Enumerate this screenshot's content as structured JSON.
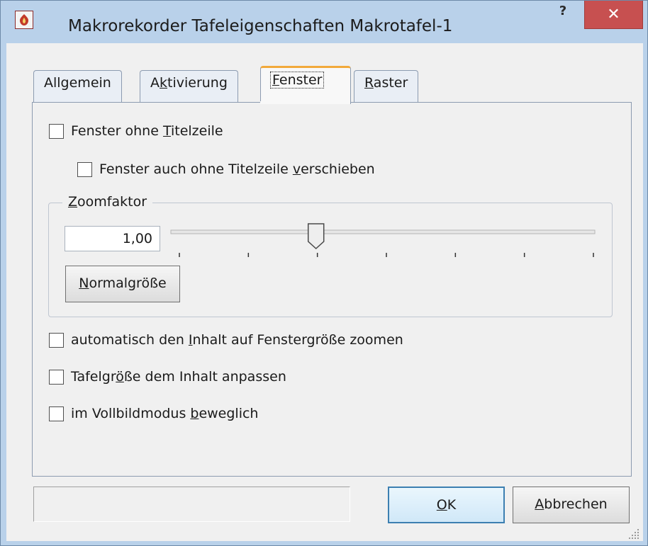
{
  "window": {
    "title": "Makrorekorder Tafeleigenschaften Makrotafel-1",
    "help_label": "?",
    "close_label": "✕"
  },
  "tabs": [
    {
      "pre": "Allgemein",
      "u": "",
      "post": ""
    },
    {
      "pre": "A",
      "u": "k",
      "post": "tivierung"
    },
    {
      "pre": "",
      "u": "F",
      "post": "enster"
    },
    {
      "pre": "",
      "u": "R",
      "post": "aster"
    }
  ],
  "active_tab": 2,
  "options": {
    "no_titlebar": {
      "pre": "Fenster ohne ",
      "u": "T",
      "post": "itelzeile",
      "checked": false
    },
    "move_without_titlebar": {
      "pre": "Fenster auch ohne Titelzeile ",
      "u": "v",
      "post": "erschieben",
      "checked": false
    },
    "auto_zoom": {
      "pre": "automatisch den ",
      "u": "I",
      "post": "nhalt auf Fenstergröße zoomen",
      "checked": false
    },
    "fit_size": {
      "pre": "Tafelgr",
      "u": "ö",
      "post": "ße dem Inhalt anpassen",
      "checked": false
    },
    "fullscreen_movable": {
      "pre": "im Vollbildmodus ",
      "u": "b",
      "post": "eweglich",
      "checked": false
    }
  },
  "zoom": {
    "legend_u": "Z",
    "legend_post": "oomfaktor",
    "value": "1,00",
    "slider_fraction": 0.33,
    "ticks": 7,
    "normal_button_u": "N",
    "normal_button_post": "ormalgröße"
  },
  "buttons": {
    "ok_u": "O",
    "ok_post": "K",
    "cancel_u": "A",
    "cancel_post": "bbrechen"
  },
  "status_text": ""
}
